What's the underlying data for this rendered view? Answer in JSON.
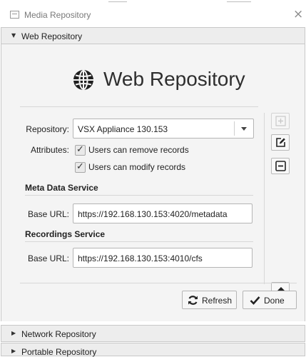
{
  "window": {
    "title": "Media Repository",
    "close_glyph": "×"
  },
  "sections": {
    "web": {
      "label": "Web Repository",
      "expanded": true,
      "arrow": "▼"
    },
    "network": {
      "label": "Network Repository",
      "expanded": false,
      "arrow": "▶"
    },
    "portable": {
      "label": "Portable Repository",
      "expanded": false,
      "arrow": "▶"
    }
  },
  "web_panel": {
    "heading": "Web Repository",
    "heading_icon": "globe-icon",
    "repository_label": "Repository:",
    "repository_value": "VSX Appliance 130.153",
    "attributes_label": "Attributes:",
    "attributes": [
      {
        "label": "Users can remove records",
        "checked": true
      },
      {
        "label": "Users can modify records",
        "checked": true
      }
    ],
    "check_glyph": "✓",
    "meta_section": {
      "title": "Meta Data Service",
      "base_url_label": "Base URL:",
      "base_url_value": "https://192.168.130.153:4020/metadata"
    },
    "recordings_section": {
      "title": "Recordings Service",
      "base_url_label": "Base URL:",
      "base_url_value": "https://192.168.130.153:4010/cfs"
    },
    "side_buttons": [
      {
        "name": "add-icon",
        "enabled": false
      },
      {
        "name": "edit-icon",
        "enabled": true
      },
      {
        "name": "remove-icon",
        "enabled": true
      },
      {
        "name": "eraser-icon",
        "enabled": true
      }
    ],
    "refresh_label": "Refresh",
    "done_label": "Done"
  },
  "colors": {
    "header_bg": "#ededed",
    "panel_bg": "#f4f4f4",
    "border": "#c8c8c8",
    "text": "#222222"
  }
}
